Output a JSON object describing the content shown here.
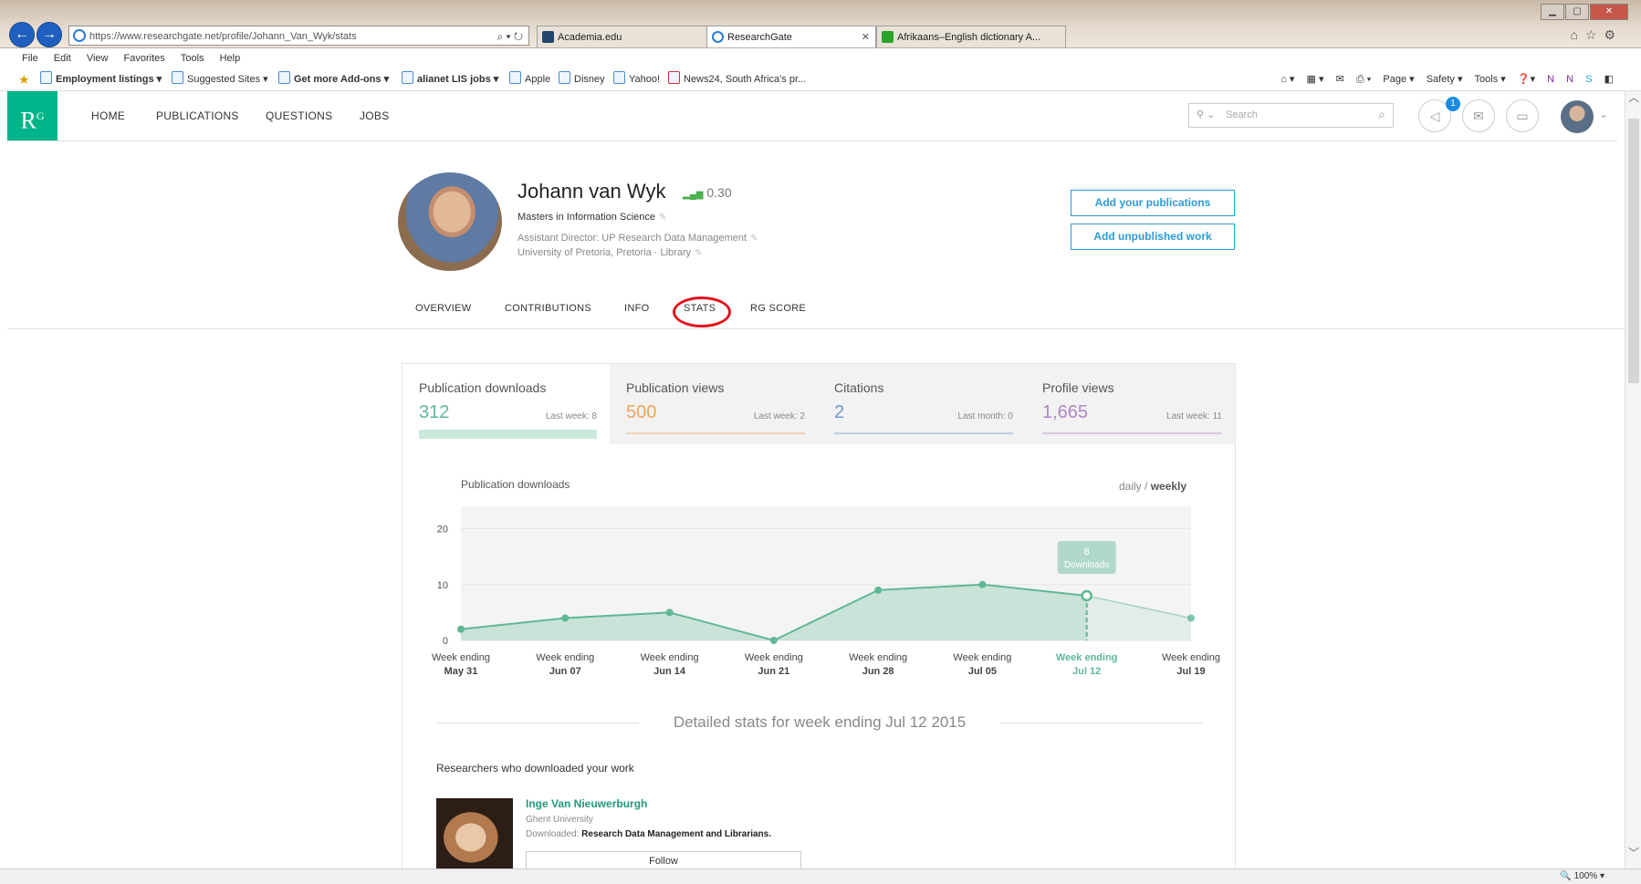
{
  "browser": {
    "url": "https://www.researchgate.net/profile/Johann_Van_Wyk/stats",
    "tabs": [
      {
        "label": "Academia.edu"
      },
      {
        "label": "ResearchGate"
      },
      {
        "label": "Afrikaans–English dictionary A..."
      }
    ],
    "menu": [
      "File",
      "Edit",
      "View",
      "Favorites",
      "Tools",
      "Help"
    ],
    "favorites": [
      {
        "label": "Employment listings ▾",
        "bold": true
      },
      {
        "label": "Suggested Sites ▾",
        "bold": false
      },
      {
        "label": "Get more Add-ons ▾",
        "bold": true
      },
      {
        "label": "alianet LIS jobs ▾",
        "bold": true
      },
      {
        "label": "Apple",
        "bold": false
      },
      {
        "label": "Disney",
        "bold": false
      },
      {
        "label": "Yahoo!",
        "bold": false
      },
      {
        "label": "News24, South Africa's pr...",
        "bold": false
      }
    ],
    "command_bar": [
      "Page ▾",
      "Safety ▾",
      "Tools ▾"
    ],
    "zoom": "100%"
  },
  "rg": {
    "logo": "R",
    "logo_sup": "G",
    "nav": [
      "HOME",
      "PUBLICATIONS",
      "QUESTIONS",
      "JOBS"
    ],
    "search_placeholder": "Search",
    "notification_count": "1"
  },
  "profile": {
    "name": "Johann van Wyk",
    "score": "0.30",
    "degree": "Masters in Information Science",
    "position": "Assistant Director: UP Research Data Management",
    "institution": "University of Pretoria, Pretoria · Library",
    "add_publications": "Add your publications",
    "add_unpublished": "Add unpublished work",
    "tabs": [
      "OVERVIEW",
      "CONTRIBUTIONS",
      "INFO",
      "STATS",
      "RG SCORE"
    ]
  },
  "stats": [
    {
      "label": "Publication downloads",
      "value": "312",
      "last": "Last week: 8",
      "color": "#5fb894"
    },
    {
      "label": "Publication views",
      "value": "500",
      "last": "Last week: 2",
      "color": "#f0a35e"
    },
    {
      "label": "Citations",
      "value": "2",
      "last": "Last month: 0",
      "color": "#6f95c9"
    },
    {
      "label": "Profile views",
      "value": "1,665",
      "last": "Last week: 11",
      "color": "#b087c4"
    }
  ],
  "chart_data": {
    "type": "area",
    "title": "Publication downloads",
    "toggle_daily": "daily",
    "toggle_sep": " / ",
    "toggle_weekly": "weekly",
    "categories": [
      [
        "Week ending",
        "May 31"
      ],
      [
        "Week ending",
        "Jun 07"
      ],
      [
        "Week ending",
        "Jun 14"
      ],
      [
        "Week ending",
        "Jun 21"
      ],
      [
        "Week ending",
        "Jun 28"
      ],
      [
        "Week ending",
        "Jul 05"
      ],
      [
        "Week ending",
        "Jul 12"
      ],
      [
        "Week ending",
        "Jul 19"
      ]
    ],
    "values": [
      2,
      4,
      5,
      0,
      9,
      10,
      8,
      4
    ],
    "yticks": [
      0,
      10,
      20
    ],
    "ylim": [
      0,
      24
    ],
    "highlight_index": 6,
    "tooltip_value": "8",
    "tooltip_label": "Downloads",
    "color": "#5fb894"
  },
  "detail": {
    "heading": "Detailed stats for week ending Jul 12 2015",
    "researchers_heading": "Researchers who downloaded your work",
    "researcher_name": "Inge Van Nieuwerburgh",
    "researcher_uni": "Ghent University",
    "downloaded_label": "Downloaded:",
    "downloaded_title": "Research Data Management and Librarians.",
    "follow": "Follow"
  }
}
